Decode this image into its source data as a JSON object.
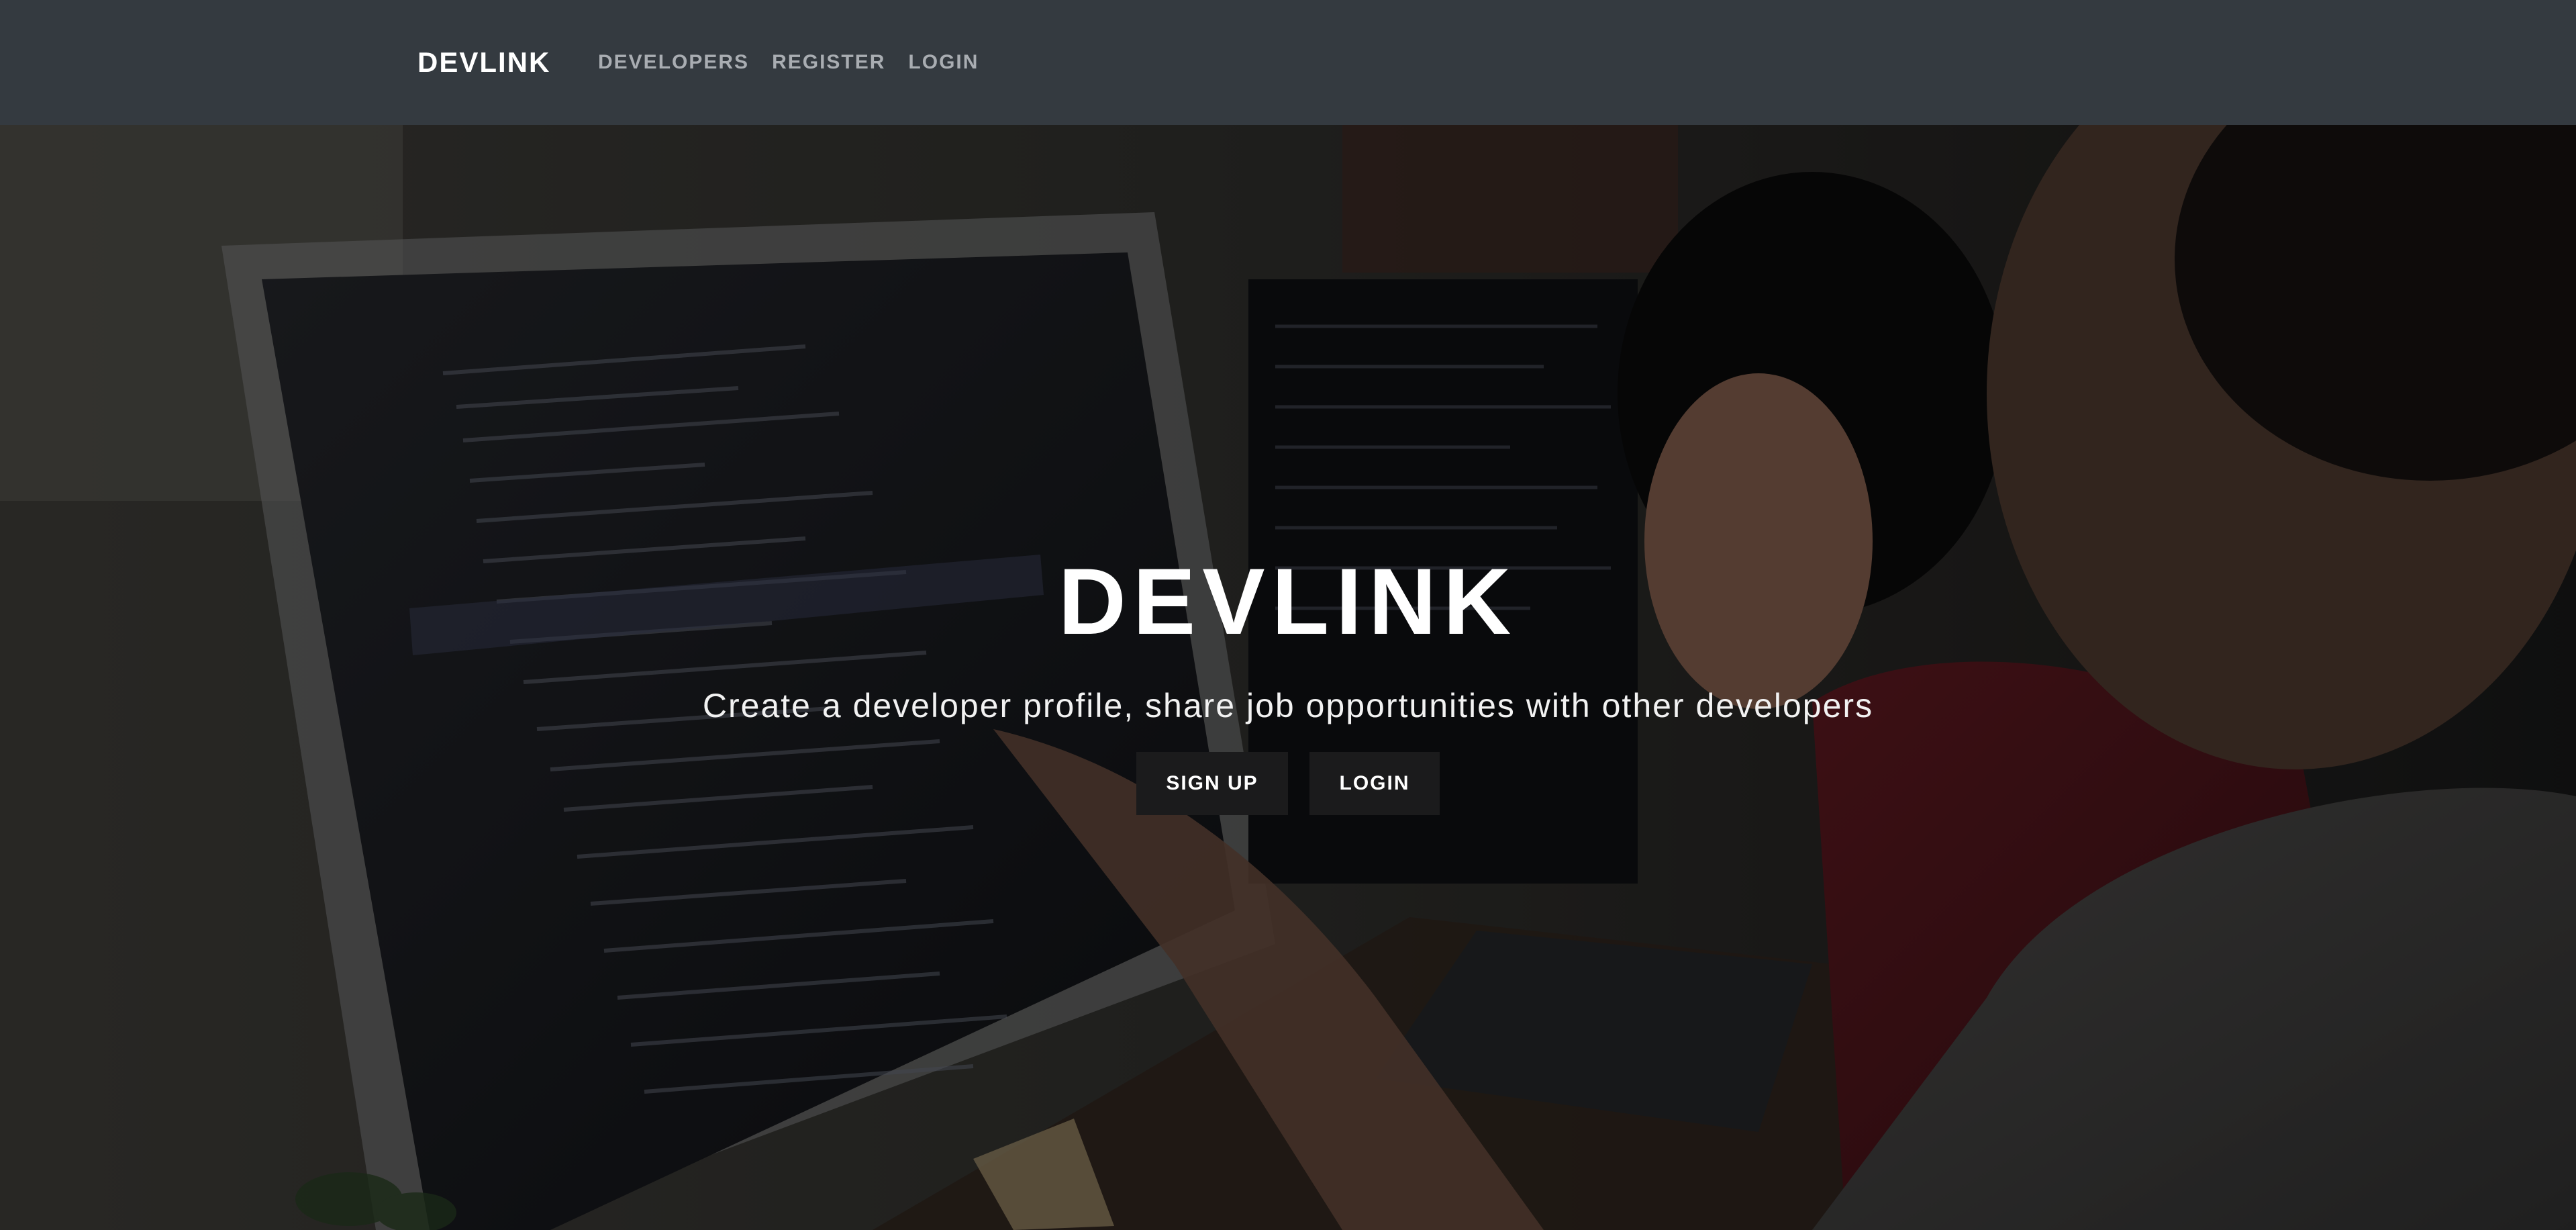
{
  "navbar": {
    "brand": "DEVLINK",
    "links": [
      {
        "label": "DEVELOPERS"
      },
      {
        "label": "REGISTER"
      },
      {
        "label": "LOGIN"
      }
    ]
  },
  "hero": {
    "title": "DEVLINK",
    "tagline": "Create a developer profile, share job opportunities with other developers",
    "buttons": {
      "signup": "SIGN UP",
      "login": "LOGIN"
    }
  },
  "colors": {
    "navbar_bg": "#343a40",
    "button_bg": "#1b1b1c",
    "text_white": "#ffffff",
    "nav_link": "#a9adb2"
  }
}
